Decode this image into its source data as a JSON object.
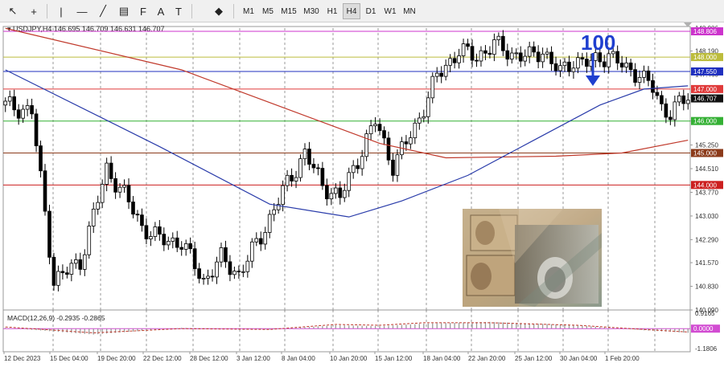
{
  "toolbar": {
    "tools": [
      {
        "name": "cursor-icon",
        "glyph": "↖"
      },
      {
        "name": "crosshair-icon",
        "glyph": "+"
      },
      {
        "name": "vertical-line-icon",
        "glyph": "|"
      },
      {
        "name": "horizontal-line-icon",
        "glyph": "—"
      },
      {
        "name": "trendline-icon",
        "glyph": "╱"
      },
      {
        "name": "channel-icon",
        "glyph": "▤"
      },
      {
        "name": "fibonacci-icon",
        "glyph": "F"
      },
      {
        "name": "text-icon",
        "glyph": "A"
      },
      {
        "name": "label-icon",
        "glyph": "T"
      },
      {
        "name": "shapes-icon",
        "glyph": "◆"
      }
    ],
    "timeframes": [
      "M1",
      "M5",
      "M15",
      "M30",
      "H1",
      "H4",
      "D1",
      "W1",
      "MN"
    ],
    "active_timeframe": "H4"
  },
  "chart_data": [
    {
      "type": "candlestick",
      "header": {
        "symbol": "USDJPY,H4",
        "ohlc": "146.695 146.709 146.631 146.707"
      },
      "ylim": [
        140.09,
        148.906
      ],
      "y_ticks": [
        "148.906",
        "148.190",
        "147.460",
        "146.730",
        "146.000",
        "145.250",
        "144.510",
        "143.770",
        "143.030",
        "142.290",
        "141.570",
        "140.830",
        "140.090"
      ],
      "x_ticks": [
        "12 Dec 2023",
        "15 Dec 04:00",
        "19 Dec 20:00",
        "22 Dec 12:00",
        "28 Dec 12:00",
        "3 Jan 12:00",
        "8 Jan 04:00",
        "10 Jan 20:00",
        "15 Jan 12:00",
        "18 Jan 04:00",
        "22 Jan 20:00",
        "25 Jan 12:00",
        "30 Jan 04:00",
        "1 Feb 20:00"
      ],
      "grid": true,
      "horizontal_levels": [
        {
          "value": 148.806,
          "label": "148.806",
          "color": "#cc33cc"
        },
        {
          "value": 148.0,
          "label": "148.000",
          "color": "#bcbc3c"
        },
        {
          "value": 147.55,
          "label": "147.550",
          "color": "#1f2fbf"
        },
        {
          "value": 147.0,
          "label": "147.000",
          "color": "#e03a3a"
        },
        {
          "value": 146.0,
          "label": "146.000",
          "color": "#34b034"
        },
        {
          "value": 145.0,
          "label": "145.000",
          "color": "#8b3a1a"
        },
        {
          "value": 144.0,
          "label": "144.000",
          "color": "#cc1f1f"
        }
      ],
      "current_price": {
        "value": 146.707,
        "label": "146.707",
        "color": "#111111"
      },
      "anchors": [
        [
          0,
          146.5
        ],
        [
          6,
          146.3
        ],
        [
          11,
          141.0
        ],
        [
          17,
          141.6
        ],
        [
          23,
          144.5
        ],
        [
          27,
          143.7
        ],
        [
          31,
          142.7
        ],
        [
          35,
          142.3
        ],
        [
          40,
          142.2
        ],
        [
          45,
          141.0
        ],
        [
          49,
          141.7
        ],
        [
          53,
          141.2
        ],
        [
          58,
          142.4
        ],
        [
          63,
          143.8
        ],
        [
          68,
          145.0
        ],
        [
          72,
          144.0
        ],
        [
          76,
          143.6
        ],
        [
          80,
          144.8
        ],
        [
          84,
          146.0
        ],
        [
          88,
          144.6
        ],
        [
          93,
          145.8
        ],
        [
          98,
          147.4
        ],
        [
          103,
          148.2
        ],
        [
          107,
          148.0
        ],
        [
          111,
          148.4
        ],
        [
          115,
          148.1
        ],
        [
          119,
          148.0
        ],
        [
          122,
          148.2
        ],
        [
          126,
          147.5
        ],
        [
          129,
          147.9
        ],
        [
          133,
          147.8
        ],
        [
          137,
          148.1
        ],
        [
          141,
          147.6
        ],
        [
          144,
          147.5
        ],
        [
          147,
          147.0
        ],
        [
          149,
          146.4
        ],
        [
          151,
          146.3
        ],
        [
          153,
          146.55
        ],
        [
          155,
          146.7
        ]
      ],
      "series": [
        {
          "name": "",
          "color": "#c0392b",
          "values": [
            [
              0,
              148.9
            ],
            [
              40,
              147.6
            ],
            [
              85,
              145.3
            ],
            [
              100,
              144.85
            ],
            [
              125,
              144.9
            ],
            [
              140,
              145.0
            ],
            [
              155,
              145.4
            ]
          ]
        },
        {
          "name": "",
          "color": "#2a3caa",
          "values": [
            [
              0,
              147.6
            ],
            [
              35,
              145.2
            ],
            [
              60,
              143.4
            ],
            [
              78,
              143.0
            ],
            [
              90,
              143.5
            ],
            [
              105,
              144.3
            ],
            [
              120,
              145.4
            ],
            [
              135,
              146.5
            ],
            [
              145,
              147.0
            ],
            [
              155,
              147.1
            ]
          ]
        }
      ],
      "annotation": {
        "text": "100",
        "color": "#1f3fcf"
      }
    },
    {
      "type": "histogram",
      "header": "MACD(12,26,9) -0.2935 -0.2865",
      "ylim": [
        -1.1806,
        0.9165
      ],
      "y_ticks": [
        "0.9165",
        "0.0000",
        "-1.1806"
      ],
      "zero_label": "0.0000",
      "x": [
        0,
        20,
        40,
        60,
        75,
        85,
        95,
        110,
        130,
        145,
        155
      ],
      "values": [
        0.05,
        -0.35,
        0.05,
        -0.05,
        0.2,
        0.15,
        0.3,
        0.4,
        0.2,
        -0.1,
        -0.25
      ],
      "signal": [
        0.1,
        -0.25,
        0.0,
        -0.05,
        0.25,
        0.2,
        0.35,
        0.35,
        0.2,
        -0.05,
        -0.2
      ]
    }
  ]
}
